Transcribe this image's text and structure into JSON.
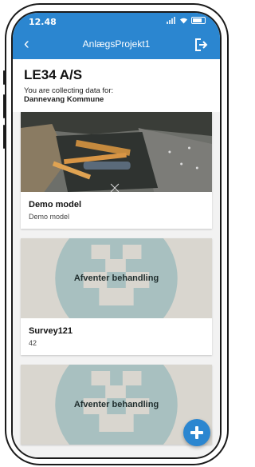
{
  "status": {
    "time": "12.48"
  },
  "header": {
    "title": "AnlægsProjekt1"
  },
  "org": {
    "name": "LE34 A/S",
    "collecting_label": "You are collecting data for:",
    "collecting_org": "Dannevang Kommune"
  },
  "cards": [
    {
      "title": "Demo model",
      "subtitle": "Demo model"
    },
    {
      "pending_label": "Afventer behandling",
      "title": "Survey121",
      "subtitle": "42"
    },
    {
      "pending_label": "Afventer behandling"
    }
  ],
  "colors": {
    "primary": "#2b86d0",
    "placeholder_bg": "#d9d6cf",
    "placeholder_icon": "#a8c0c0"
  },
  "icons": {
    "back": "chevron-left-icon",
    "logout": "logout-icon",
    "add": "plus-icon"
  }
}
